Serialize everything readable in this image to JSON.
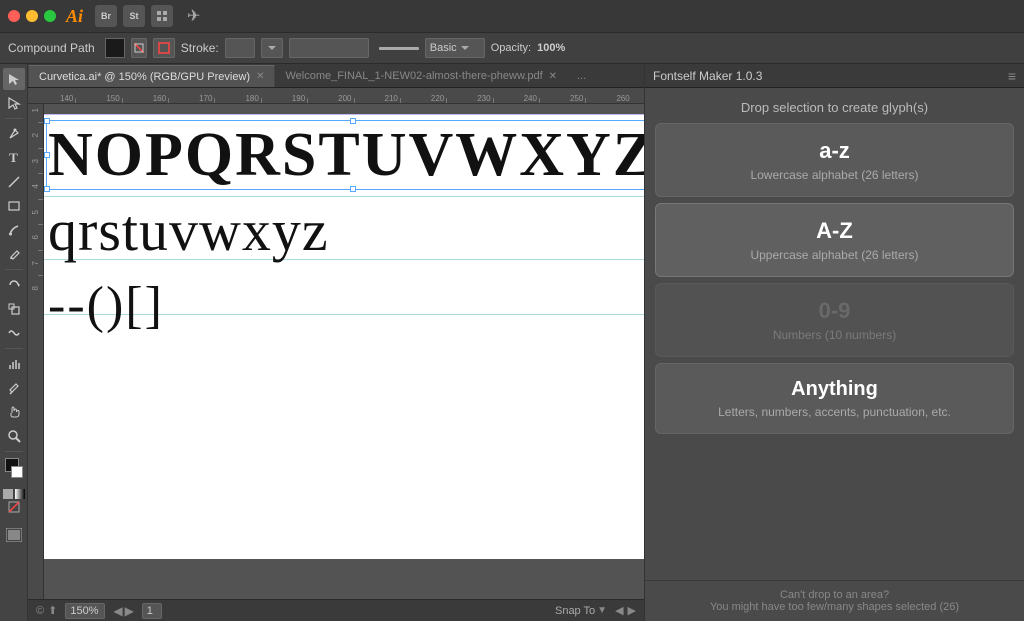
{
  "titlebar": {
    "app_name": "Ai",
    "icons": [
      "Br",
      "St",
      "grid",
      "arrow"
    ],
    "window_buttons": [
      "close",
      "minimize",
      "maximize"
    ]
  },
  "toolbar": {
    "compound_path_label": "Compound Path",
    "stroke_label": "Stroke:",
    "mode_label": "Basic",
    "opacity_label": "Opacity:",
    "opacity_value": "100%"
  },
  "tabs": [
    {
      "label": "Curvetica.ai* @ 150% (RGB/GPU Preview)",
      "active": true
    },
    {
      "label": "Welcome_FINAL_1-NEW02-almost-there-pheww.pdf",
      "active": false
    },
    {
      "label": "...",
      "active": false
    }
  ],
  "ruler": {
    "marks": [
      "140",
      "150",
      "160",
      "170",
      "180",
      "190",
      "200",
      "210",
      "220",
      "230",
      "240",
      "250",
      "260"
    ]
  },
  "canvas": {
    "uppercase_text": "NOPQRSTUVWXYZ",
    "lowercase_text": "qrstuvwxyz",
    "special_text": "--()[]"
  },
  "statusbar": {
    "zoom": "150%",
    "artboard": "1",
    "snap_label": "Snap To",
    "icons": [
      "©",
      "⬆"
    ]
  },
  "fontself_panel": {
    "title": "Fontself Maker 1.0.3",
    "subtitle": "Drop selection to create glyph(s)",
    "cards": [
      {
        "id": "lowercase",
        "title": "a-z",
        "description": "Lowercase alphabet (26 letters)",
        "active": true,
        "dimmed": false
      },
      {
        "id": "uppercase",
        "title": "A-Z",
        "description": "Uppercase alphabet (26 letters)",
        "active": true,
        "dimmed": false
      },
      {
        "id": "numbers",
        "title": "0-9",
        "description": "Numbers (10 numbers)",
        "active": false,
        "dimmed": true
      },
      {
        "id": "anything",
        "title": "Anything",
        "description": "Letters, numbers, accents, punctuation, etc.",
        "active": true,
        "dimmed": false
      }
    ],
    "footer_line1": "Can't drop to an area?",
    "footer_line2": "You might have too few/many shapes selected (26)"
  }
}
